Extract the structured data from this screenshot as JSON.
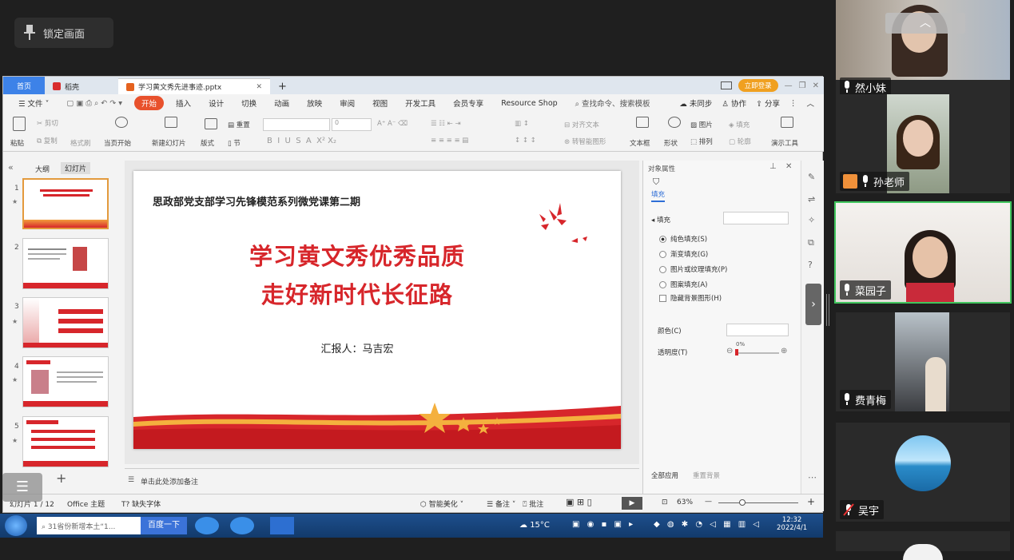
{
  "lock": {
    "label": "锁定画面"
  },
  "wps": {
    "tabs": {
      "home": "首页",
      "daoke": "稻壳",
      "doc_title": "学习黄文秀先进事迹.pptx",
      "login": "立即登录"
    },
    "menu": {
      "file": "文件",
      "items": [
        "开始",
        "插入",
        "设计",
        "切换",
        "动画",
        "放映",
        "审阅",
        "视图",
        "开发工具",
        "会员专享",
        "Resource Shop"
      ],
      "search": "查找命令、搜索模板",
      "sync": "未同步",
      "collab": "协作",
      "share": "分享"
    },
    "ribbon": {
      "paste": "粘贴",
      "cut": "剪切",
      "copy": "复制",
      "format_painter": "格式刷",
      "from_current": "当页开始",
      "new_slide": "新建幻灯片",
      "layout": "版式",
      "section": "节",
      "reset": "重置",
      "font_size": "0",
      "align_text": "对齐文本",
      "smartart": "转智能图形",
      "textbox": "文本框",
      "shape": "形状",
      "picture": "图片",
      "arrange": "排列",
      "fill": "填充",
      "outline": "轮廓",
      "presenter": "演示工具"
    },
    "left_pane": {
      "tab_outline": "大纲",
      "tab_slides": "幻灯片",
      "slide_numbers": [
        "1",
        "2",
        "3",
        "4",
        "5"
      ]
    },
    "slide": {
      "header": "思政部党支部学习先锋模范系列微党课第二期",
      "title_line1": "学习黄文秀优秀品质",
      "title_line2": "走好新时代长征路",
      "reporter": "汇报人：马吉宏"
    },
    "notes_placeholder": "单击此处添加备注",
    "object_panel": {
      "title": "对象属性",
      "fill_tab": "填充",
      "fill_section": "填充",
      "options": [
        "纯色填充(S)",
        "渐变填充(G)",
        "图片或纹理填充(P)",
        "图案填充(A)"
      ],
      "hide_bg": "隐藏背景图形(H)",
      "color_label": "颜色(C)",
      "transparency_label": "透明度(T)",
      "transparency_value": "0%",
      "apply_all": "全部应用",
      "reset_bg": "重置背景"
    },
    "status": {
      "slide_counter": "幻灯片 1 / 12",
      "theme": "Office 主题",
      "missing_font": "缺失字体",
      "beautify": "智能美化",
      "notes": "备注",
      "comments": "批注",
      "zoom": "63%"
    }
  },
  "taskbar": {
    "search": "31省份新增本土“1...",
    "baidu": "百度一下",
    "weather": "15°C",
    "time": "12:32",
    "date": "2022/4/1"
  },
  "participants": [
    {
      "name": "然小妹"
    },
    {
      "name": "孙老师"
    },
    {
      "name": "菜园子"
    },
    {
      "name": "费青梅"
    },
    {
      "name": "吴宇"
    }
  ],
  "colors": {
    "accent_red": "#d7262b",
    "wps_orange": "#e8512c",
    "active_speaker": "#40c55d"
  }
}
